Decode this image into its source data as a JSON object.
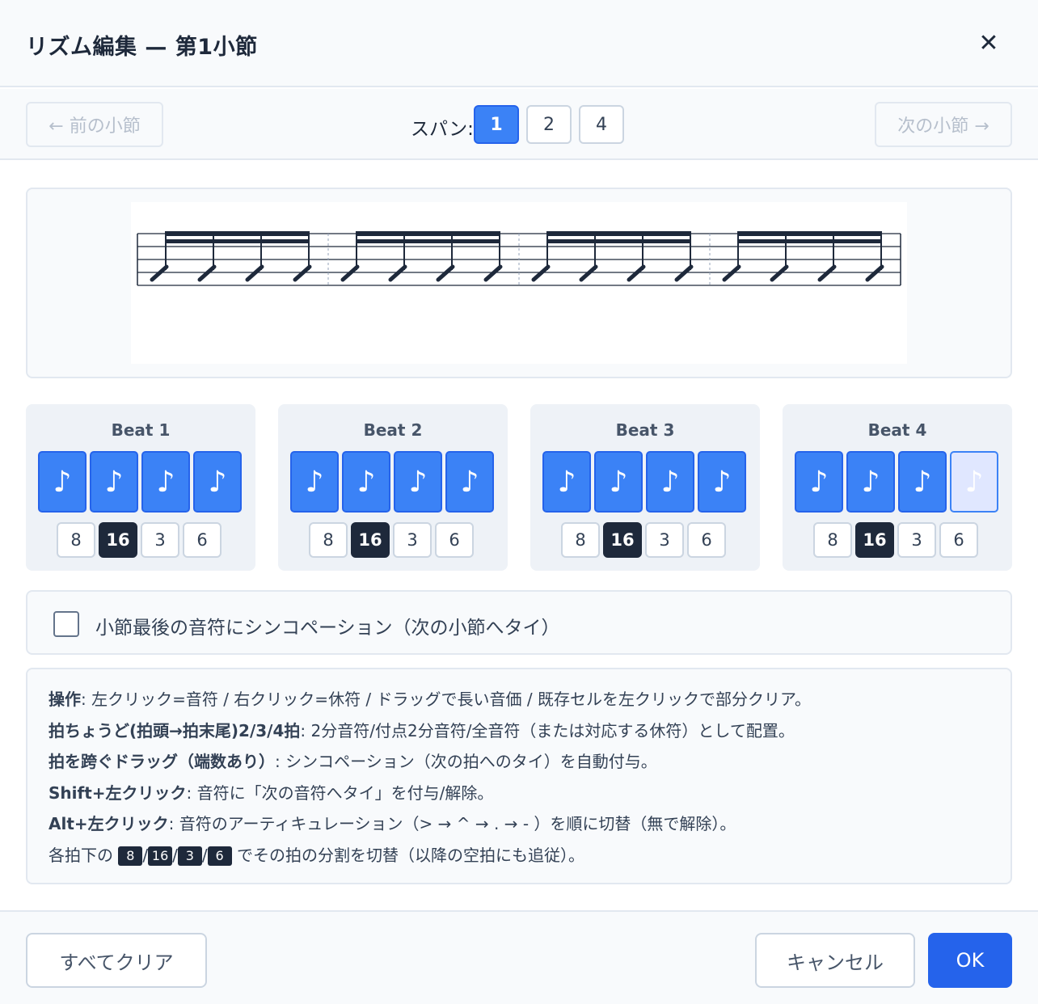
{
  "header": {
    "title": "リズム編集 — 第1小節",
    "close_icon": "close-icon"
  },
  "nav": {
    "prev_label": "← 前の小節",
    "next_label": "次の小節 →",
    "span_label": "スパン:",
    "span_options": [
      "1",
      "2",
      "4"
    ],
    "span_selected": "1"
  },
  "beats": [
    {
      "title": "Beat 1",
      "cells": [
        "♪",
        "♪",
        "♪",
        "♪"
      ],
      "divisions": [
        "8",
        "16",
        "3",
        "6"
      ],
      "selected_division": "16"
    },
    {
      "title": "Beat 2",
      "cells": [
        "♪",
        "♪",
        "♪",
        "♪"
      ],
      "divisions": [
        "8",
        "16",
        "3",
        "6"
      ],
      "selected_division": "16"
    },
    {
      "title": "Beat 3",
      "cells": [
        "♪",
        "♪",
        "♪",
        "♪"
      ],
      "divisions": [
        "8",
        "16",
        "3",
        "6"
      ],
      "selected_division": "16"
    },
    {
      "title": "Beat 4",
      "cells": [
        "♪",
        "♪",
        "♪",
        "♪"
      ],
      "divisions": [
        "8",
        "16",
        "3",
        "6"
      ],
      "selected_division": "16"
    }
  ],
  "sync": {
    "label": "小節最後の音符にシンコペーション（次の小節へタイ）",
    "checked": false
  },
  "help": {
    "line1_bold": "操作",
    "line1_text": ": 左クリック=音符 / 右クリック=休符 / ドラッグで長い音価 / 既存セルを左クリックで部分クリア。",
    "line2_bold": "拍ちょうど(拍頭→拍末尾)2/3/4拍",
    "line2_text": ": 2分音符/付点2分音符/全音符（または対応する休符）として配置。",
    "line3_bold": "拍を跨ぐドラッグ（端数あり）",
    "line3_text": ": シンコペーション（次の拍へのタイ）を自動付与。",
    "line4_bold": "Shift+左クリック",
    "line4_text": ": 音符に「次の音符へタイ」を付与/解除。",
    "line5_bold": "Alt+左クリック",
    "line5_text": ": 音符のアーティキュレーション（> → ^ → . → ‐ ）を順に切替（無で解除）。",
    "line6_pre": "各拍下の ",
    "line6_keys": [
      "8",
      "16",
      "3",
      "6"
    ],
    "line6_sep": "/",
    "line6_post": " でその拍の分割を切替（以降の空拍にも追従）。"
  },
  "footer": {
    "clear_label": "すべてクリア",
    "cancel_label": "キャンセル",
    "ok_label": "OK"
  }
}
